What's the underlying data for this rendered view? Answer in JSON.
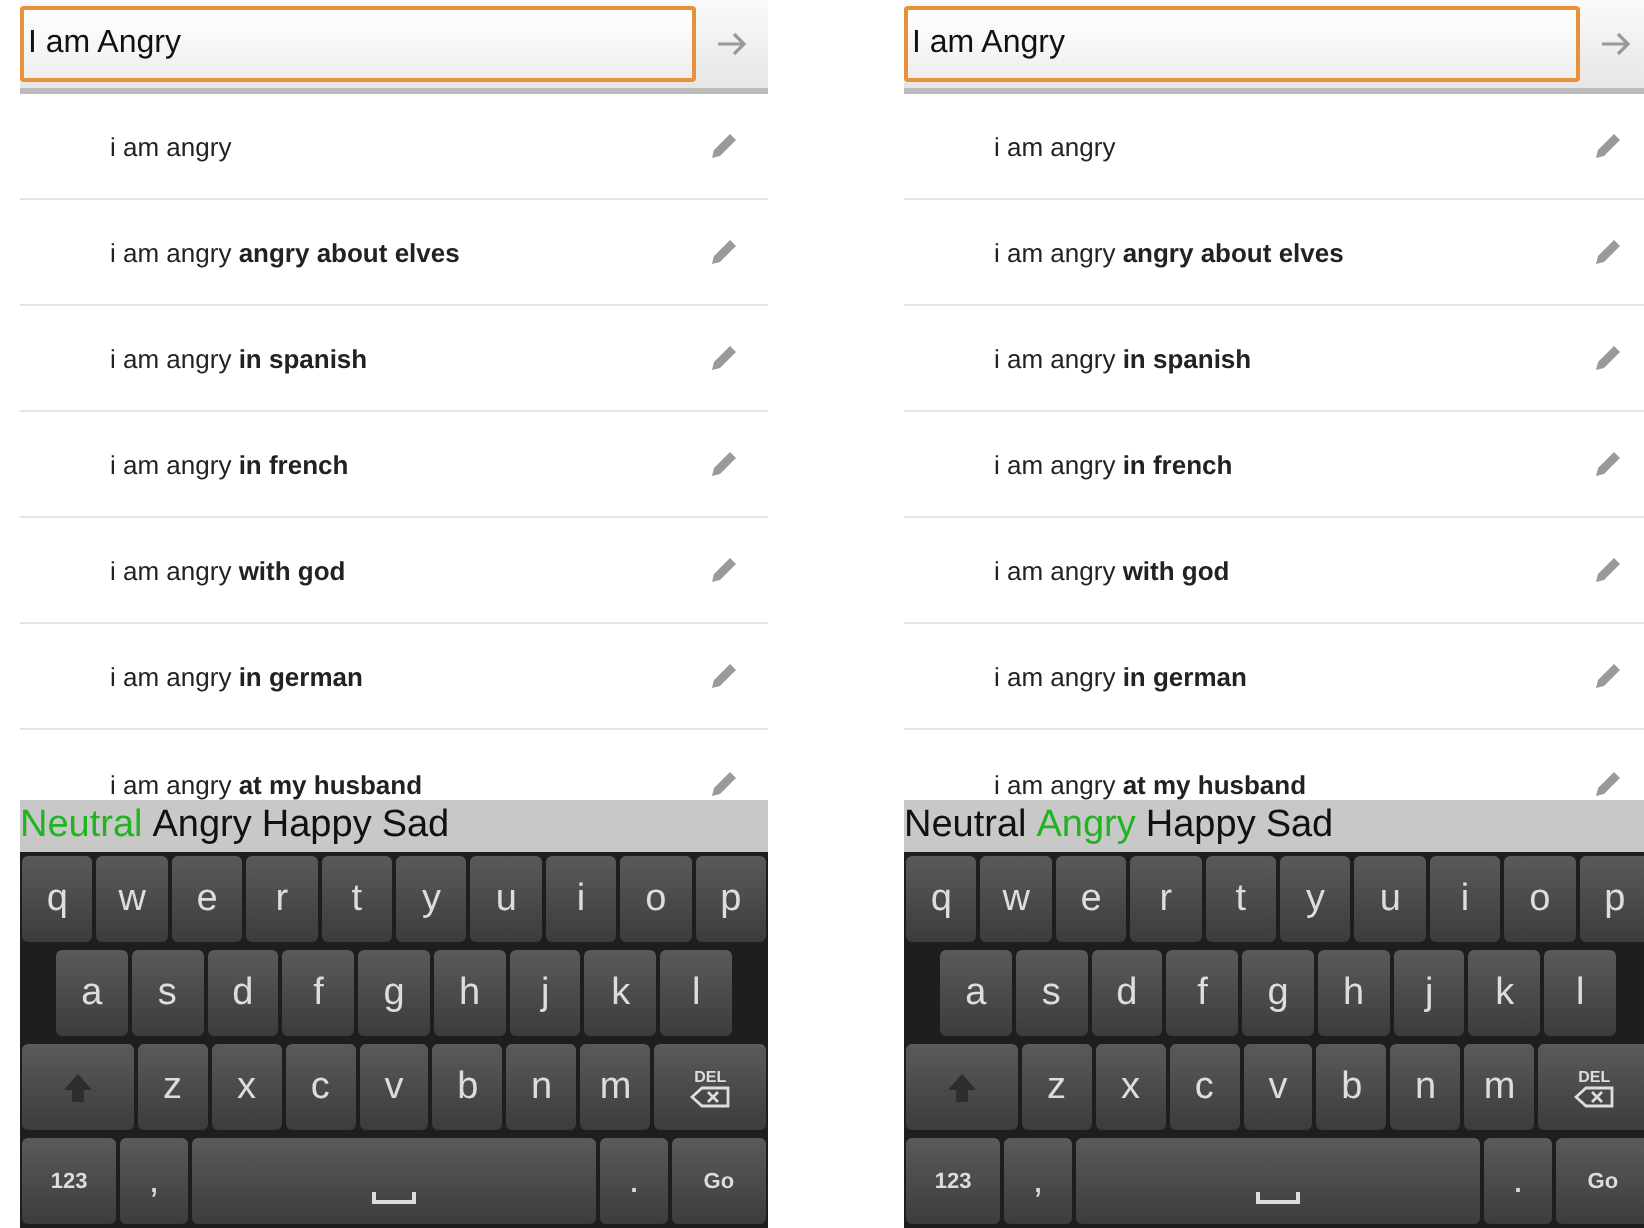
{
  "screens": [
    {
      "search": {
        "value": "I am Angry"
      },
      "suggestions": [
        "i am angry",
        "i am angry **angry about elves**",
        "i am angry **in spanish**",
        "i am angry **in french**",
        "i am angry **with god**",
        "i am angry **in german**",
        "i am angry **at my husband**"
      ],
      "moods": [
        {
          "label": "Neutral",
          "selected": true
        },
        {
          "label": "Angry",
          "selected": false
        },
        {
          "label": "Happy",
          "selected": false
        },
        {
          "label": "Sad",
          "selected": false
        }
      ],
      "keyboard": [
        [
          {
            "kind": "char",
            "label": "q"
          },
          {
            "kind": "char",
            "label": "w"
          },
          {
            "kind": "char",
            "label": "e"
          },
          {
            "kind": "char",
            "label": "r"
          },
          {
            "kind": "char",
            "label": "t"
          },
          {
            "kind": "char",
            "label": "y"
          },
          {
            "kind": "char",
            "label": "u"
          },
          {
            "kind": "char",
            "label": "i"
          },
          {
            "kind": "char",
            "label": "o"
          },
          {
            "kind": "char",
            "label": "p"
          }
        ],
        [
          {
            "kind": "char",
            "label": "a"
          },
          {
            "kind": "char",
            "label": "s"
          },
          {
            "kind": "char",
            "label": "d"
          },
          {
            "kind": "char",
            "label": "f"
          },
          {
            "kind": "char",
            "label": "g"
          },
          {
            "kind": "char",
            "label": "h"
          },
          {
            "kind": "char",
            "label": "j"
          },
          {
            "kind": "char",
            "label": "k"
          },
          {
            "kind": "char",
            "label": "l"
          }
        ],
        [
          {
            "kind": "shift"
          },
          {
            "kind": "char",
            "label": "z"
          },
          {
            "kind": "char",
            "label": "x"
          },
          {
            "kind": "char",
            "label": "c"
          },
          {
            "kind": "char",
            "label": "v"
          },
          {
            "kind": "char",
            "label": "b"
          },
          {
            "kind": "char",
            "label": "n"
          },
          {
            "kind": "char",
            "label": "m"
          },
          {
            "kind": "del",
            "label": "DEL"
          }
        ],
        [
          {
            "kind": "small",
            "label": "123"
          },
          {
            "kind": "char",
            "label": ","
          },
          {
            "kind": "space"
          },
          {
            "kind": "char",
            "label": "."
          },
          {
            "kind": "small",
            "label": "Go"
          }
        ]
      ]
    },
    {
      "search": {
        "value": "I am Angry"
      },
      "suggestions": [
        "i am angry",
        "i am angry **angry about elves**",
        "i am angry **in spanish**",
        "i am angry **in french**",
        "i am angry **with god**",
        "i am angry **in german**",
        "i am angry **at my husband**"
      ],
      "moods": [
        {
          "label": "Neutral",
          "selected": false
        },
        {
          "label": "Angry",
          "selected": true
        },
        {
          "label": "Happy",
          "selected": false
        },
        {
          "label": "Sad",
          "selected": false
        }
      ],
      "keyboard": [
        [
          {
            "kind": "char",
            "label": "q"
          },
          {
            "kind": "char",
            "label": "w"
          },
          {
            "kind": "char",
            "label": "e"
          },
          {
            "kind": "char",
            "label": "r"
          },
          {
            "kind": "char",
            "label": "t"
          },
          {
            "kind": "char",
            "label": "y"
          },
          {
            "kind": "char",
            "label": "u"
          },
          {
            "kind": "char",
            "label": "i"
          },
          {
            "kind": "char",
            "label": "o"
          },
          {
            "kind": "char",
            "label": "p"
          }
        ],
        [
          {
            "kind": "char",
            "label": "a"
          },
          {
            "kind": "char",
            "label": "s"
          },
          {
            "kind": "char",
            "label": "d"
          },
          {
            "kind": "char",
            "label": "f"
          },
          {
            "kind": "char",
            "label": "g"
          },
          {
            "kind": "char",
            "label": "h"
          },
          {
            "kind": "char",
            "label": "j"
          },
          {
            "kind": "char",
            "label": "k"
          },
          {
            "kind": "char",
            "label": "l"
          }
        ],
        [
          {
            "kind": "shift"
          },
          {
            "kind": "char",
            "label": "z"
          },
          {
            "kind": "char",
            "label": "x"
          },
          {
            "kind": "char",
            "label": "c"
          },
          {
            "kind": "char",
            "label": "v"
          },
          {
            "kind": "char",
            "label": "b"
          },
          {
            "kind": "char",
            "label": "n"
          },
          {
            "kind": "char",
            "label": "m"
          },
          {
            "kind": "del",
            "label": "DEL"
          }
        ],
        [
          {
            "kind": "small",
            "label": "123"
          },
          {
            "kind": "char",
            "label": ","
          },
          {
            "kind": "space"
          },
          {
            "kind": "char",
            "label": "."
          },
          {
            "kind": "small",
            "label": "Go"
          }
        ]
      ]
    }
  ]
}
